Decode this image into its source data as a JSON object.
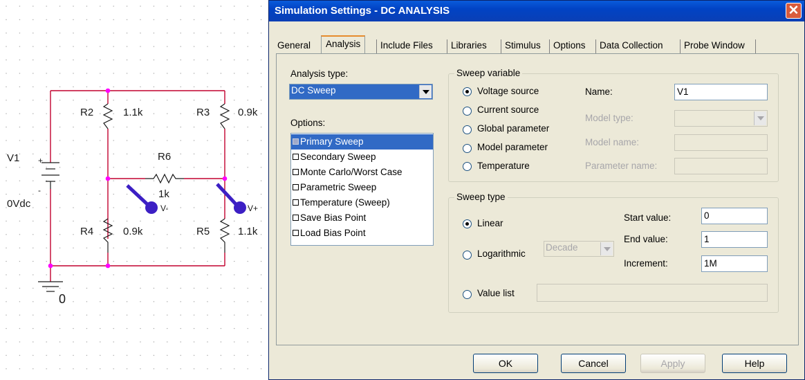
{
  "schematic": {
    "v1_name": "V1",
    "v1_value": "0Vdc",
    "r2_name": "R2",
    "r2_value": "1.1k",
    "r3_name": "R3",
    "r3_value": "0.9k",
    "r4_name": "R4",
    "r4_value": "0.9k",
    "r5_name": "R5",
    "r5_value": "1.1k",
    "r6_name": "R6",
    "r6_value": "1k",
    "probe_minus": "V-",
    "probe_plus": "V+",
    "plus_sign": "+",
    "minus_sign": "-",
    "ground_label": "0",
    "wire_color": "#c2002e",
    "node_color": "#ff00ff",
    "probe_color": "#3c1fc4"
  },
  "dialog": {
    "title": "Simulation Settings - DC ANALYSIS",
    "close_label": "✕",
    "tabs": [
      "General",
      "Analysis",
      "Include Files",
      "Libraries",
      "Stimulus",
      "Options",
      "Data Collection",
      "Probe Window"
    ],
    "active_tab": "Analysis",
    "analysis_type_label": "Analysis type:",
    "analysis_type_value": "DC Sweep",
    "options_label": "Options:",
    "options": [
      {
        "label": "Primary Sweep",
        "checked": true
      },
      {
        "label": "Secondary Sweep",
        "checked": false
      },
      {
        "label": "Monte Carlo/Worst Case",
        "checked": false
      },
      {
        "label": "Parametric Sweep",
        "checked": false
      },
      {
        "label": "Temperature (Sweep)",
        "checked": false
      },
      {
        "label": "Save Bias Point",
        "checked": false
      },
      {
        "label": "Load Bias Point",
        "checked": false
      }
    ],
    "sweep_variable": {
      "title": "Sweep variable",
      "radios": [
        "Voltage source",
        "Current source",
        "Global parameter",
        "Model parameter",
        "Temperature"
      ],
      "selected": "Voltage source",
      "name_label": "Name:",
      "name_value": "V1",
      "model_type_label": "Model type:",
      "model_name_label": "Model name:",
      "parameter_name_label": "Parameter name:"
    },
    "sweep_type": {
      "title": "Sweep type",
      "linear_label": "Linear",
      "log_label": "Logarithmic",
      "log_scale_value": "Decade",
      "value_list_label": "Value list",
      "selected": "Linear",
      "start_label": "Start value:",
      "start_value": "0",
      "end_label": "End value:",
      "end_value": "1",
      "increment_label": "Increment:",
      "increment_value": "1M"
    },
    "buttons": {
      "ok": "OK",
      "cancel": "Cancel",
      "apply": "Apply",
      "help": "Help"
    }
  }
}
